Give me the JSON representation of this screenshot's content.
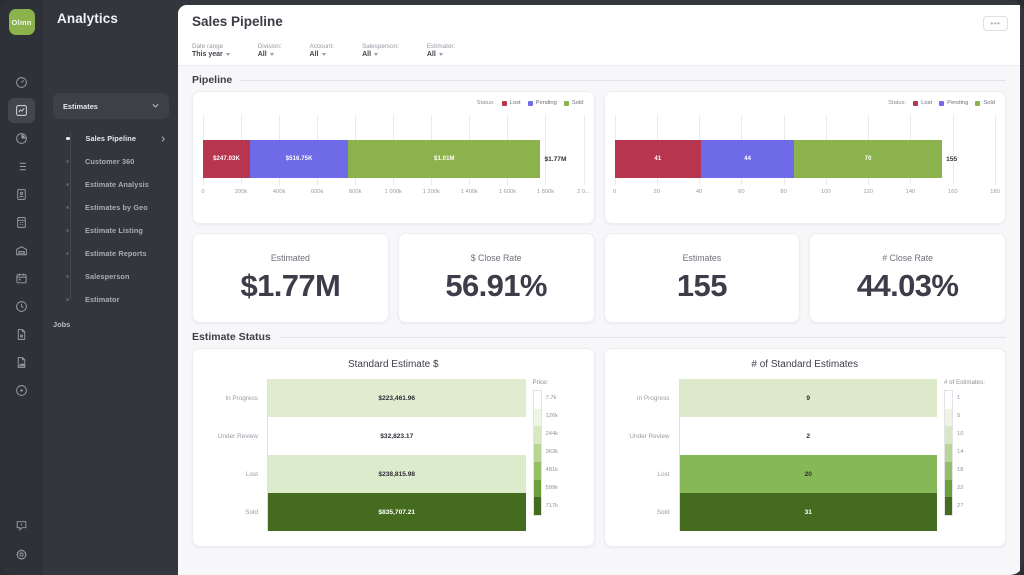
{
  "brand": {
    "logo_text": "Olmn",
    "logo_color": "#8cb24e"
  },
  "app": {
    "title": "Analytics"
  },
  "rail": {
    "icons": [
      {
        "name": "dashboard-gauge-icon"
      },
      {
        "name": "analytics-chart-icon"
      },
      {
        "name": "pie-chart-icon"
      },
      {
        "name": "list-icon"
      },
      {
        "name": "contact-card-icon"
      },
      {
        "name": "building-icon"
      },
      {
        "name": "warehouse-icon"
      },
      {
        "name": "calendar-icon"
      },
      {
        "name": "clock-icon"
      },
      {
        "name": "document-lock-icon"
      },
      {
        "name": "file-image-icon"
      },
      {
        "name": "play-circle-icon"
      }
    ],
    "bottom_icons": [
      {
        "name": "help-chat-icon"
      },
      {
        "name": "settings-gear-icon"
      }
    ]
  },
  "nav": {
    "group_label": "Estimates",
    "items": [
      {
        "label": "Sales Pipeline",
        "current": true
      },
      {
        "label": "Customer 360",
        "current": false
      },
      {
        "label": "Estimate Analysis",
        "current": false
      },
      {
        "label": "Estimates by Geo",
        "current": false
      },
      {
        "label": "Estimate Listing",
        "current": false
      },
      {
        "label": "Estimate Reports",
        "current": false
      },
      {
        "label": "Salesperson",
        "current": false
      },
      {
        "label": "Estimator",
        "current": false
      }
    ],
    "section_label": "Jobs"
  },
  "header": {
    "page_title": "Sales Pipeline",
    "kebab_label": "•••"
  },
  "filters": [
    {
      "label": "Date range",
      "value": "This year"
    },
    {
      "label": "Division:",
      "value": "All"
    },
    {
      "label": "Account:",
      "value": "All"
    },
    {
      "label": "Salesperson:",
      "value": "All"
    },
    {
      "label": "Estimator:",
      "value": "All"
    }
  ],
  "sections": {
    "pipeline": "Pipeline",
    "estimate_status": "Estimate Status"
  },
  "legend": {
    "title": "Status:",
    "items": [
      {
        "label": "Lost",
        "color": "#b8354f"
      },
      {
        "label": "Pending",
        "color": "#6e6ae8"
      },
      {
        "label": "Sold",
        "color": "#8cb24e"
      }
    ]
  },
  "kpis": [
    {
      "label": "Estimated",
      "value": "$1.77M"
    },
    {
      "label": "$ Close Rate",
      "value": "56.91%"
    },
    {
      "label": "Estimates",
      "value": "155"
    },
    {
      "label": "# Close Rate",
      "value": "44.03%"
    }
  ],
  "chart_data": [
    {
      "type": "bar",
      "id": "pipeline-dollars",
      "orientation": "horizontal",
      "stacked": true,
      "title": "",
      "xlabel": "",
      "ylabel": "",
      "xlim": [
        0,
        2000000
      ],
      "grid": true,
      "legend": "top-right",
      "categories": [
        "Total"
      ],
      "series": [
        {
          "name": "Lost",
          "color": "#b8354f",
          "values": [
            247030
          ],
          "label": "$247.03K"
        },
        {
          "name": "Pending",
          "color": "#6e6ae8",
          "values": [
            516750
          ],
          "label": "$516.75K"
        },
        {
          "name": "Sold",
          "color": "#8cb24e",
          "values": [
            1010000
          ],
          "label": "$1.01M"
        }
      ],
      "total_label": "$1.77M",
      "ticks": [
        "0",
        "200k",
        "400k",
        "600k",
        "800k",
        "1 000k",
        "1 200k",
        "1 400k",
        "1 600k",
        "1 800k",
        "2 0..."
      ],
      "tick_values": [
        0,
        200000,
        400000,
        600000,
        800000,
        1000000,
        1200000,
        1400000,
        1600000,
        1800000,
        2000000
      ]
    },
    {
      "type": "bar",
      "id": "pipeline-counts",
      "orientation": "horizontal",
      "stacked": true,
      "title": "",
      "xlabel": "",
      "ylabel": "",
      "xlim": [
        0,
        180
      ],
      "grid": true,
      "legend": "top-right",
      "categories": [
        "Total"
      ],
      "series": [
        {
          "name": "Lost",
          "color": "#b8354f",
          "values": [
            41
          ],
          "label": "41"
        },
        {
          "name": "Pending",
          "color": "#6e6ae8",
          "values": [
            44
          ],
          "label": "44"
        },
        {
          "name": "Sold",
          "color": "#8cb24e",
          "values": [
            70
          ],
          "label": "70"
        }
      ],
      "total_label": "155",
      "ticks": [
        "0",
        "20",
        "40",
        "60",
        "80",
        "100",
        "120",
        "140",
        "160",
        "180"
      ],
      "tick_values": [
        0,
        20,
        40,
        60,
        80,
        100,
        120,
        140,
        160,
        180
      ]
    },
    {
      "type": "heatmap",
      "id": "standard-estimate-dollars",
      "title": "Standard Estimate $",
      "xlabel": "",
      "ylabel": "",
      "categories": [
        "In Progress",
        "Under Review",
        "Lost",
        "Sold"
      ],
      "values": [
        223461.96,
        32823.17,
        238815.98,
        835707.21
      ],
      "value_labels": [
        "$223,461.96",
        "$32,823.17",
        "$238,815.98",
        "$835,707.21"
      ],
      "cell_colors": [
        "#dfecd0",
        "#ffffff",
        "#dcebcc",
        "#456b1e"
      ],
      "scale": {
        "title": "Price:",
        "ticks": [
          "7.7k",
          "126k",
          "244k",
          "363k",
          "481k",
          "599k",
          "717k"
        ],
        "colors": [
          "#ffffff",
          "#eef5e5",
          "#d7e8c3",
          "#b7d595",
          "#93bf67",
          "#6ca03c",
          "#456b1e"
        ]
      }
    },
    {
      "type": "heatmap",
      "id": "standard-estimate-counts",
      "title": "# of Standard Estimates",
      "xlabel": "",
      "ylabel": "",
      "categories": [
        "In Progress",
        "Under Review",
        "Lost",
        "Sold"
      ],
      "values": [
        9,
        2,
        20,
        31
      ],
      "value_labels": [
        "9",
        "2",
        "20",
        "31"
      ],
      "cell_colors": [
        "#dceacb",
        "#ffffff",
        "#86b857",
        "#456b1e"
      ],
      "scale": {
        "title": "# of Estimates:",
        "ticks": [
          "1",
          "5",
          "10",
          "14",
          "18",
          "22",
          "27"
        ],
        "colors": [
          "#ffffff",
          "#eef5e5",
          "#d7e8c3",
          "#b7d595",
          "#93bf67",
          "#6ca03c",
          "#456b1e"
        ]
      }
    }
  ]
}
